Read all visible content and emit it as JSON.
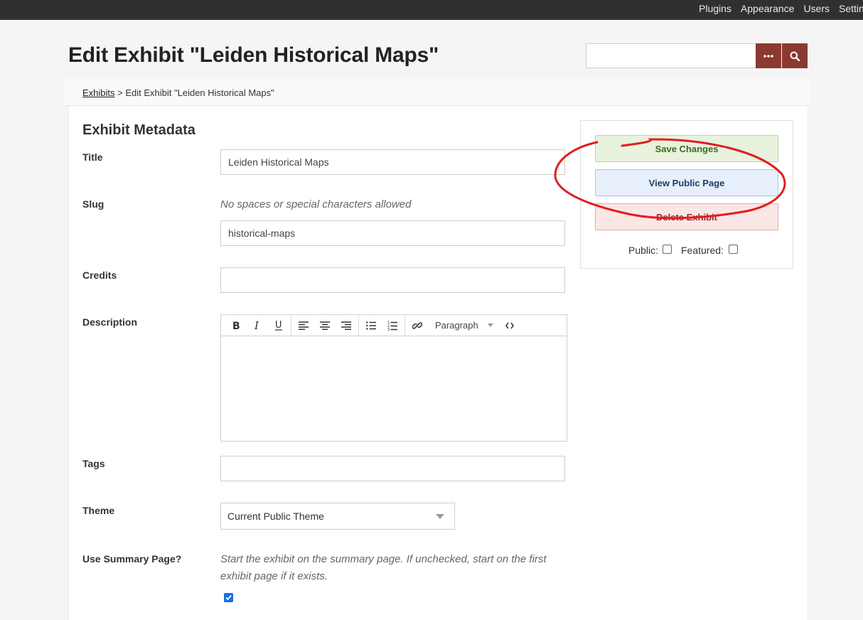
{
  "topnav": [
    "Plugins",
    "Appearance",
    "Users",
    "Settings"
  ],
  "header": {
    "title": "Edit Exhibit \"Leiden Historical Maps\""
  },
  "breadcrumb": {
    "link": "Exhibits",
    "separator": " > ",
    "current": "Edit Exhibit \"Leiden Historical Maps\""
  },
  "form": {
    "section_title": "Exhibit Metadata",
    "title": {
      "label": "Title",
      "value": "Leiden Historical Maps"
    },
    "slug": {
      "label": "Slug",
      "hint": "No spaces or special characters allowed",
      "value": "historical-maps"
    },
    "credits": {
      "label": "Credits",
      "value": ""
    },
    "description": {
      "label": "Description",
      "format": "Paragraph"
    },
    "tags": {
      "label": "Tags",
      "value": ""
    },
    "theme": {
      "label": "Theme",
      "value": "Current Public Theme"
    },
    "summary": {
      "label": "Use Summary Page?",
      "hint_line1": "Start the exhibit on the summary page. If unchecked, start on the first",
      "hint_line2": "exhibit page if it exists.",
      "checked": true
    }
  },
  "side": {
    "save": "Save Changes",
    "view": "View Public Page",
    "delete": "Delete Exhibit",
    "public_label": "Public:",
    "featured_label": "Featured:",
    "public_checked": false,
    "featured_checked": false
  },
  "colors": {
    "brand": "#8a3a30",
    "annotation": "#e01e1e",
    "checkbox": "#1a6ee6"
  },
  "icons": [
    "more-options-icon",
    "search-icon",
    "bold-icon",
    "italic-icon",
    "underline-icon",
    "align-left-icon",
    "align-center-icon",
    "align-right-icon",
    "bullet-list-icon",
    "numbered-list-icon",
    "link-icon",
    "code-icon",
    "chevron-down-icon",
    "check-icon"
  ]
}
